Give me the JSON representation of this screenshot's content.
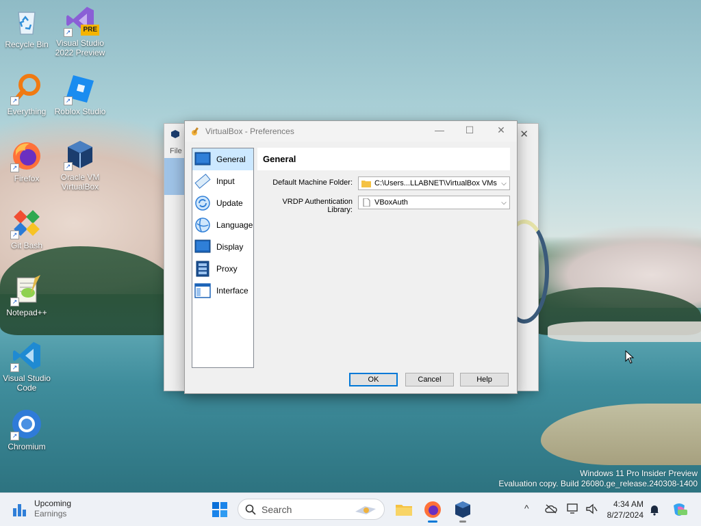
{
  "desktop": {
    "icons": [
      {
        "label": "Recycle Bin"
      },
      {
        "label": "Visual Studio 2022 Preview",
        "badge": "PRE"
      },
      {
        "label": "Everything"
      },
      {
        "label": "Roblox Studio"
      },
      {
        "label": "Firefox"
      },
      {
        "label": "Oracle VM VirtualBox"
      },
      {
        "label": "Git Bash"
      },
      {
        "label": "Notepad++"
      },
      {
        "label": "Visual Studio Code"
      },
      {
        "label": "Chromium"
      }
    ],
    "watermark": {
      "line1": "Windows 11 Pro Insider Preview",
      "line2": "Evaluation copy. Build 26080.ge_release.240308-1400"
    }
  },
  "background_window": {
    "menu_file": "File",
    "close_glyph": "✕"
  },
  "dialog": {
    "title": "VirtualBox - Preferences",
    "controls": {
      "minimize": "—",
      "maximize": "☐",
      "close": "✕"
    },
    "nav": [
      {
        "label": "General",
        "icon": "general-icon"
      },
      {
        "label": "Input",
        "icon": "input-icon"
      },
      {
        "label": "Update",
        "icon": "update-icon"
      },
      {
        "label": "Language",
        "icon": "language-icon"
      },
      {
        "label": "Display",
        "icon": "display-icon"
      },
      {
        "label": "Proxy",
        "icon": "proxy-icon"
      },
      {
        "label": "Interface",
        "icon": "interface-icon"
      }
    ],
    "section_title": "General",
    "fields": {
      "machine_folder_label": "Default Machine Folder:",
      "machine_folder_value": "C:\\Users...LLABNET\\VirtualBox VMs",
      "vrdp_label": "VRDP Authentication Library:",
      "vrdp_value": "VBoxAuth"
    },
    "buttons": {
      "ok": "OK",
      "cancel": "Cancel",
      "help": "Help"
    }
  },
  "taskbar": {
    "news_title": "Upcoming",
    "news_subtitle": "Earnings",
    "search_label": "Search",
    "tray_chevron": "^",
    "clock_time": "4:34 AM",
    "clock_date": "8/27/2024"
  },
  "colors": {
    "accent": "#0078d7",
    "nav_selected": "#cce8ff",
    "taskbar": "#eef1f6"
  }
}
